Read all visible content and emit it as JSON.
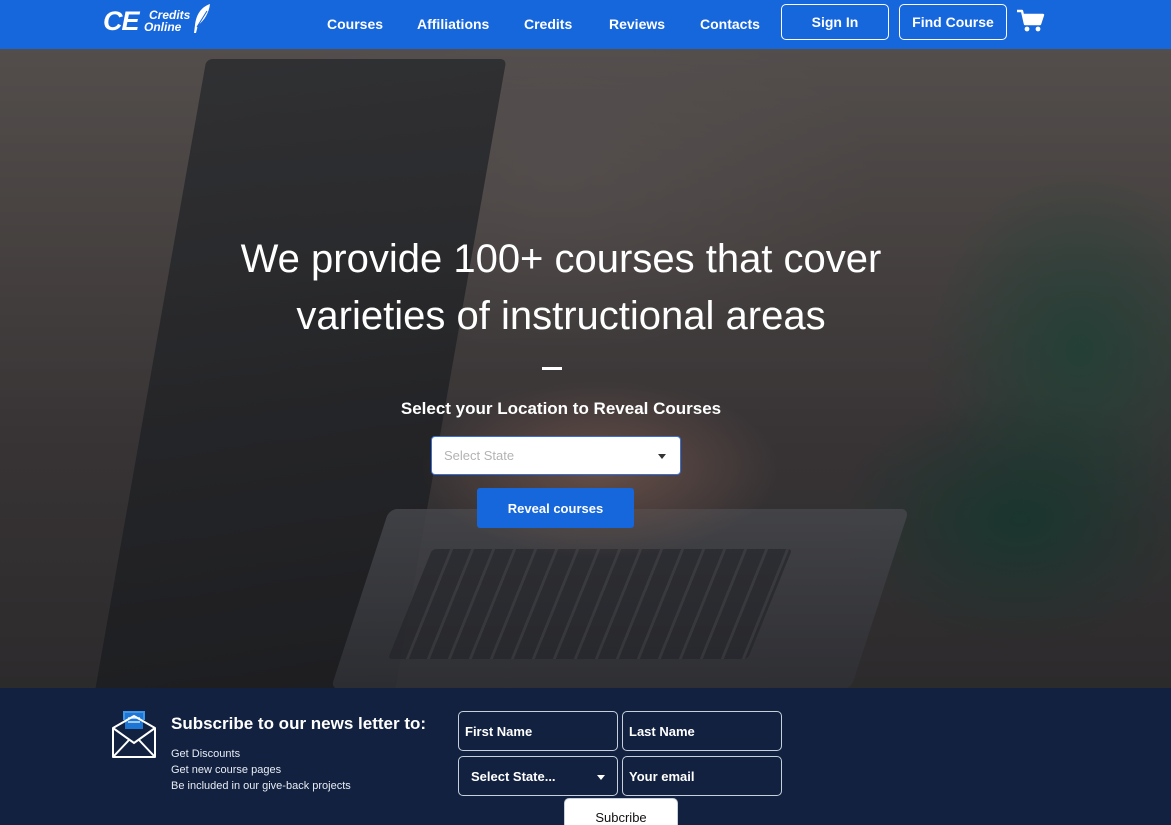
{
  "nav": {
    "logo_main": "CE",
    "logo_sub_1": "Credits",
    "logo_sub_2": "Online",
    "links": [
      "Courses",
      "Affiliations",
      "Credits",
      "Reviews",
      "Contacts"
    ],
    "signin_label": "Sign In",
    "find_course_label": "Find Course",
    "cart_icon": "shopping-cart-icon"
  },
  "hero": {
    "title_line1": "We provide 100+ courses that cover",
    "title_line2": "varieties of instructional areas",
    "subtitle": "Select your Location to Reveal Courses",
    "select_placeholder": "Select State",
    "reveal_label": "Reveal courses"
  },
  "newsletter": {
    "title": "Subscribe to our news letter to:",
    "benefits": [
      "Get Discounts",
      "Get new course pages",
      "Be included in our give-back projects"
    ],
    "first_name": "First Name",
    "last_name": "Last Name",
    "state": "Select State...",
    "email": "Your email",
    "subscribe_label": "Subcribe",
    "icon": "envelope-icon"
  },
  "colors": {
    "brand_blue": "#1666dc",
    "footer_navy": "#11213f"
  }
}
